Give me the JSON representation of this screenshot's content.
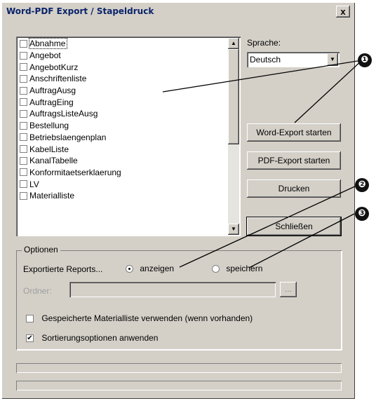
{
  "window": {
    "title": "Word-PDF Export / Stapeldruck",
    "close_label": "x"
  },
  "reports": {
    "items": [
      "Abnahme",
      "Angebot",
      "AngebotKurz",
      "Anschriftenliste",
      "AuftragAusg",
      "AuftragEing",
      "AuftragsListeAusg",
      "Bestellung",
      "Betriebslaengenplan",
      "KabelListe",
      "KanalTabelle",
      "Konformitaetserklaerung",
      "LV",
      "Materialliste"
    ]
  },
  "language": {
    "label": "Sprache:",
    "value": "Deutsch"
  },
  "buttons": {
    "word_export": "Word-Export starten",
    "pdf_export": "PDF-Export starten",
    "print": "Drucken",
    "close": "Schließen"
  },
  "options": {
    "legend": "Optionen",
    "exported_label": "Exportierte Reports...",
    "radio_show": "anzeigen",
    "radio_save": "speichern",
    "selected_radio": "anzeigen",
    "folder_label": "Ordner:",
    "folder_value": "",
    "browse_label": "...",
    "use_saved_materials": "Gespeicherte Materialliste verwenden (wenn vorhanden)",
    "use_saved_materials_checked": false,
    "apply_sort": "Sortierungsoptionen anwenden",
    "apply_sort_checked": true
  },
  "callouts": [
    "❶",
    "❷",
    "❸"
  ],
  "colors": {
    "title_text": "#0a246a",
    "face": "#d4d0c8",
    "callout": "#111111"
  }
}
